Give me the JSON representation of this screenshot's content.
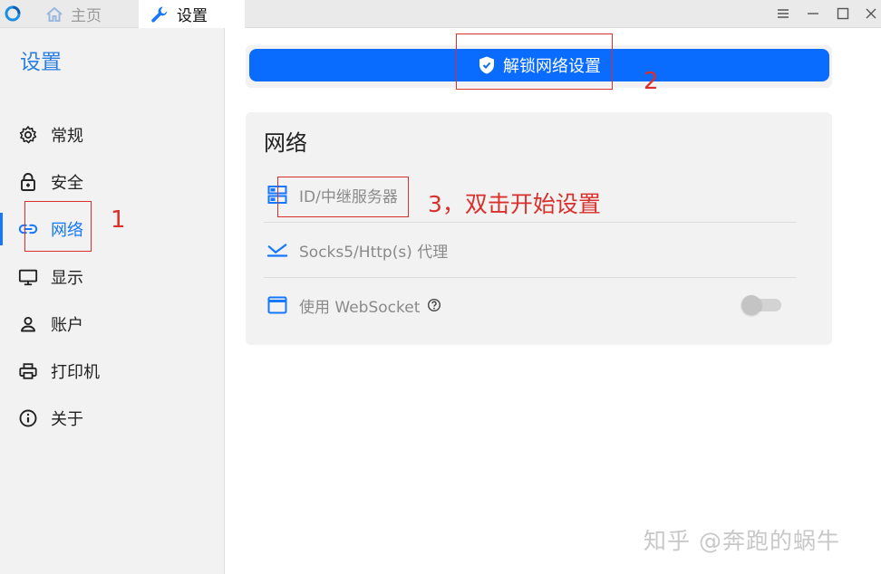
{
  "titlebar": {
    "tabs": [
      {
        "label": "主页",
        "icon": "home-icon"
      },
      {
        "label": "设置",
        "icon": "wrench-icon"
      }
    ]
  },
  "sidebar": {
    "title": "设置",
    "items": [
      {
        "label": "常规",
        "icon": "gear-icon"
      },
      {
        "label": "安全",
        "icon": "lock-icon"
      },
      {
        "label": "网络",
        "icon": "link-icon",
        "active": true
      },
      {
        "label": "显示",
        "icon": "monitor-icon"
      },
      {
        "label": "账户",
        "icon": "user-icon"
      },
      {
        "label": "打印机",
        "icon": "printer-icon"
      },
      {
        "label": "关于",
        "icon": "info-icon"
      }
    ]
  },
  "main": {
    "unlock_label": "解锁网络设置",
    "network": {
      "title": "网络",
      "rows": [
        {
          "label": "ID/中继服务器",
          "icon": "server-icon"
        },
        {
          "label": "Socks5/Http(s) 代理",
          "icon": "proxy-icon"
        },
        {
          "label": "使用 WebSocket",
          "icon": "window-icon",
          "toggle": false
        }
      ]
    }
  },
  "annotations": {
    "step1": "1",
    "step2": "2",
    "step3": "3，双击开始设置"
  },
  "watermark": "知乎 @奔跑的蜗牛",
  "colors": {
    "accent": "#0a6cff",
    "sidebar_title": "#2b7fe0",
    "annotation": "#d9302c"
  }
}
